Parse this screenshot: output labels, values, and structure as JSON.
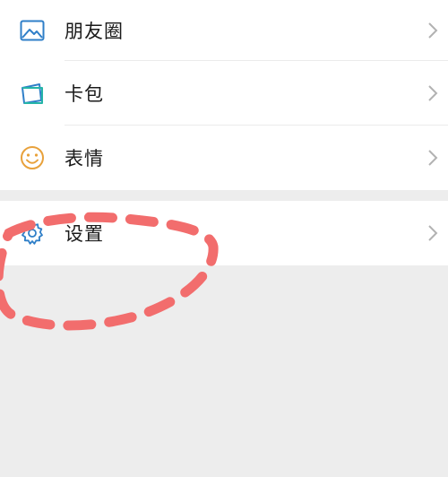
{
  "menu": {
    "items": [
      {
        "label": "朋友圈",
        "icon": "moments-icon"
      },
      {
        "label": "卡包",
        "icon": "card-wallet-icon"
      },
      {
        "label": "表情",
        "icon": "smiley-icon"
      }
    ],
    "settings": {
      "label": "设置",
      "icon": "gear-icon"
    }
  },
  "colors": {
    "icon_blue": "#2f7fc8",
    "icon_orange": "#e8a13b",
    "annotation_red": "#f26d6d",
    "chevron": "#b2b2b2"
  }
}
